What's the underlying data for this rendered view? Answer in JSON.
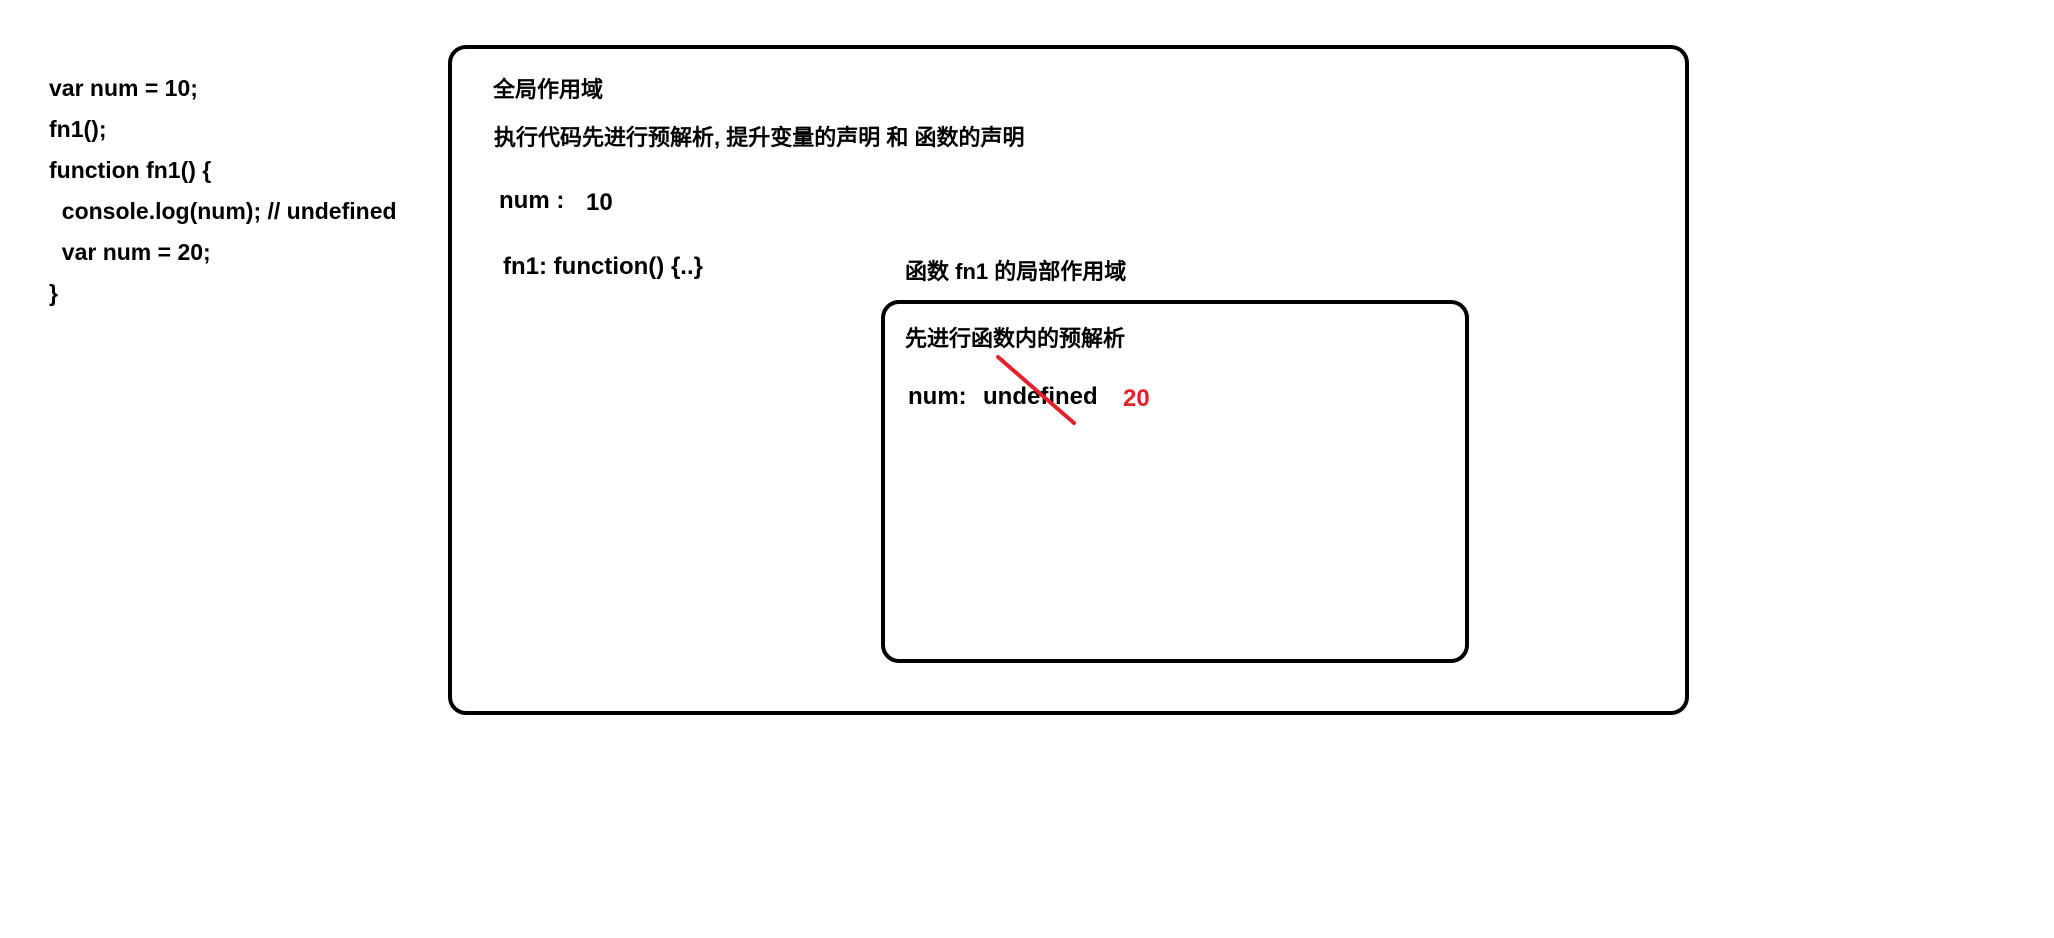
{
  "code": {
    "lines": [
      "var num = 10;",
      "fn1();",
      "function fn1() {",
      "  console.log(num); // undefined",
      "  var num = 20;",
      "}"
    ]
  },
  "global_scope": {
    "title": "全局作用域",
    "description": "执行代码先进行预解析, 提升变量的声明 和 函数的声明",
    "num_label": "num :",
    "num_value": "10",
    "fn1_label": "fn1: function() {..}",
    "local_scope_caption": "函数 fn1 的局部作用域"
  },
  "local_scope": {
    "description": "先进行函数内的预解析",
    "num_label": "num:",
    "num_old_value": "undefined",
    "num_new_value": "20"
  },
  "colors": {
    "border": "#000000",
    "highlight": "#e4202a"
  }
}
